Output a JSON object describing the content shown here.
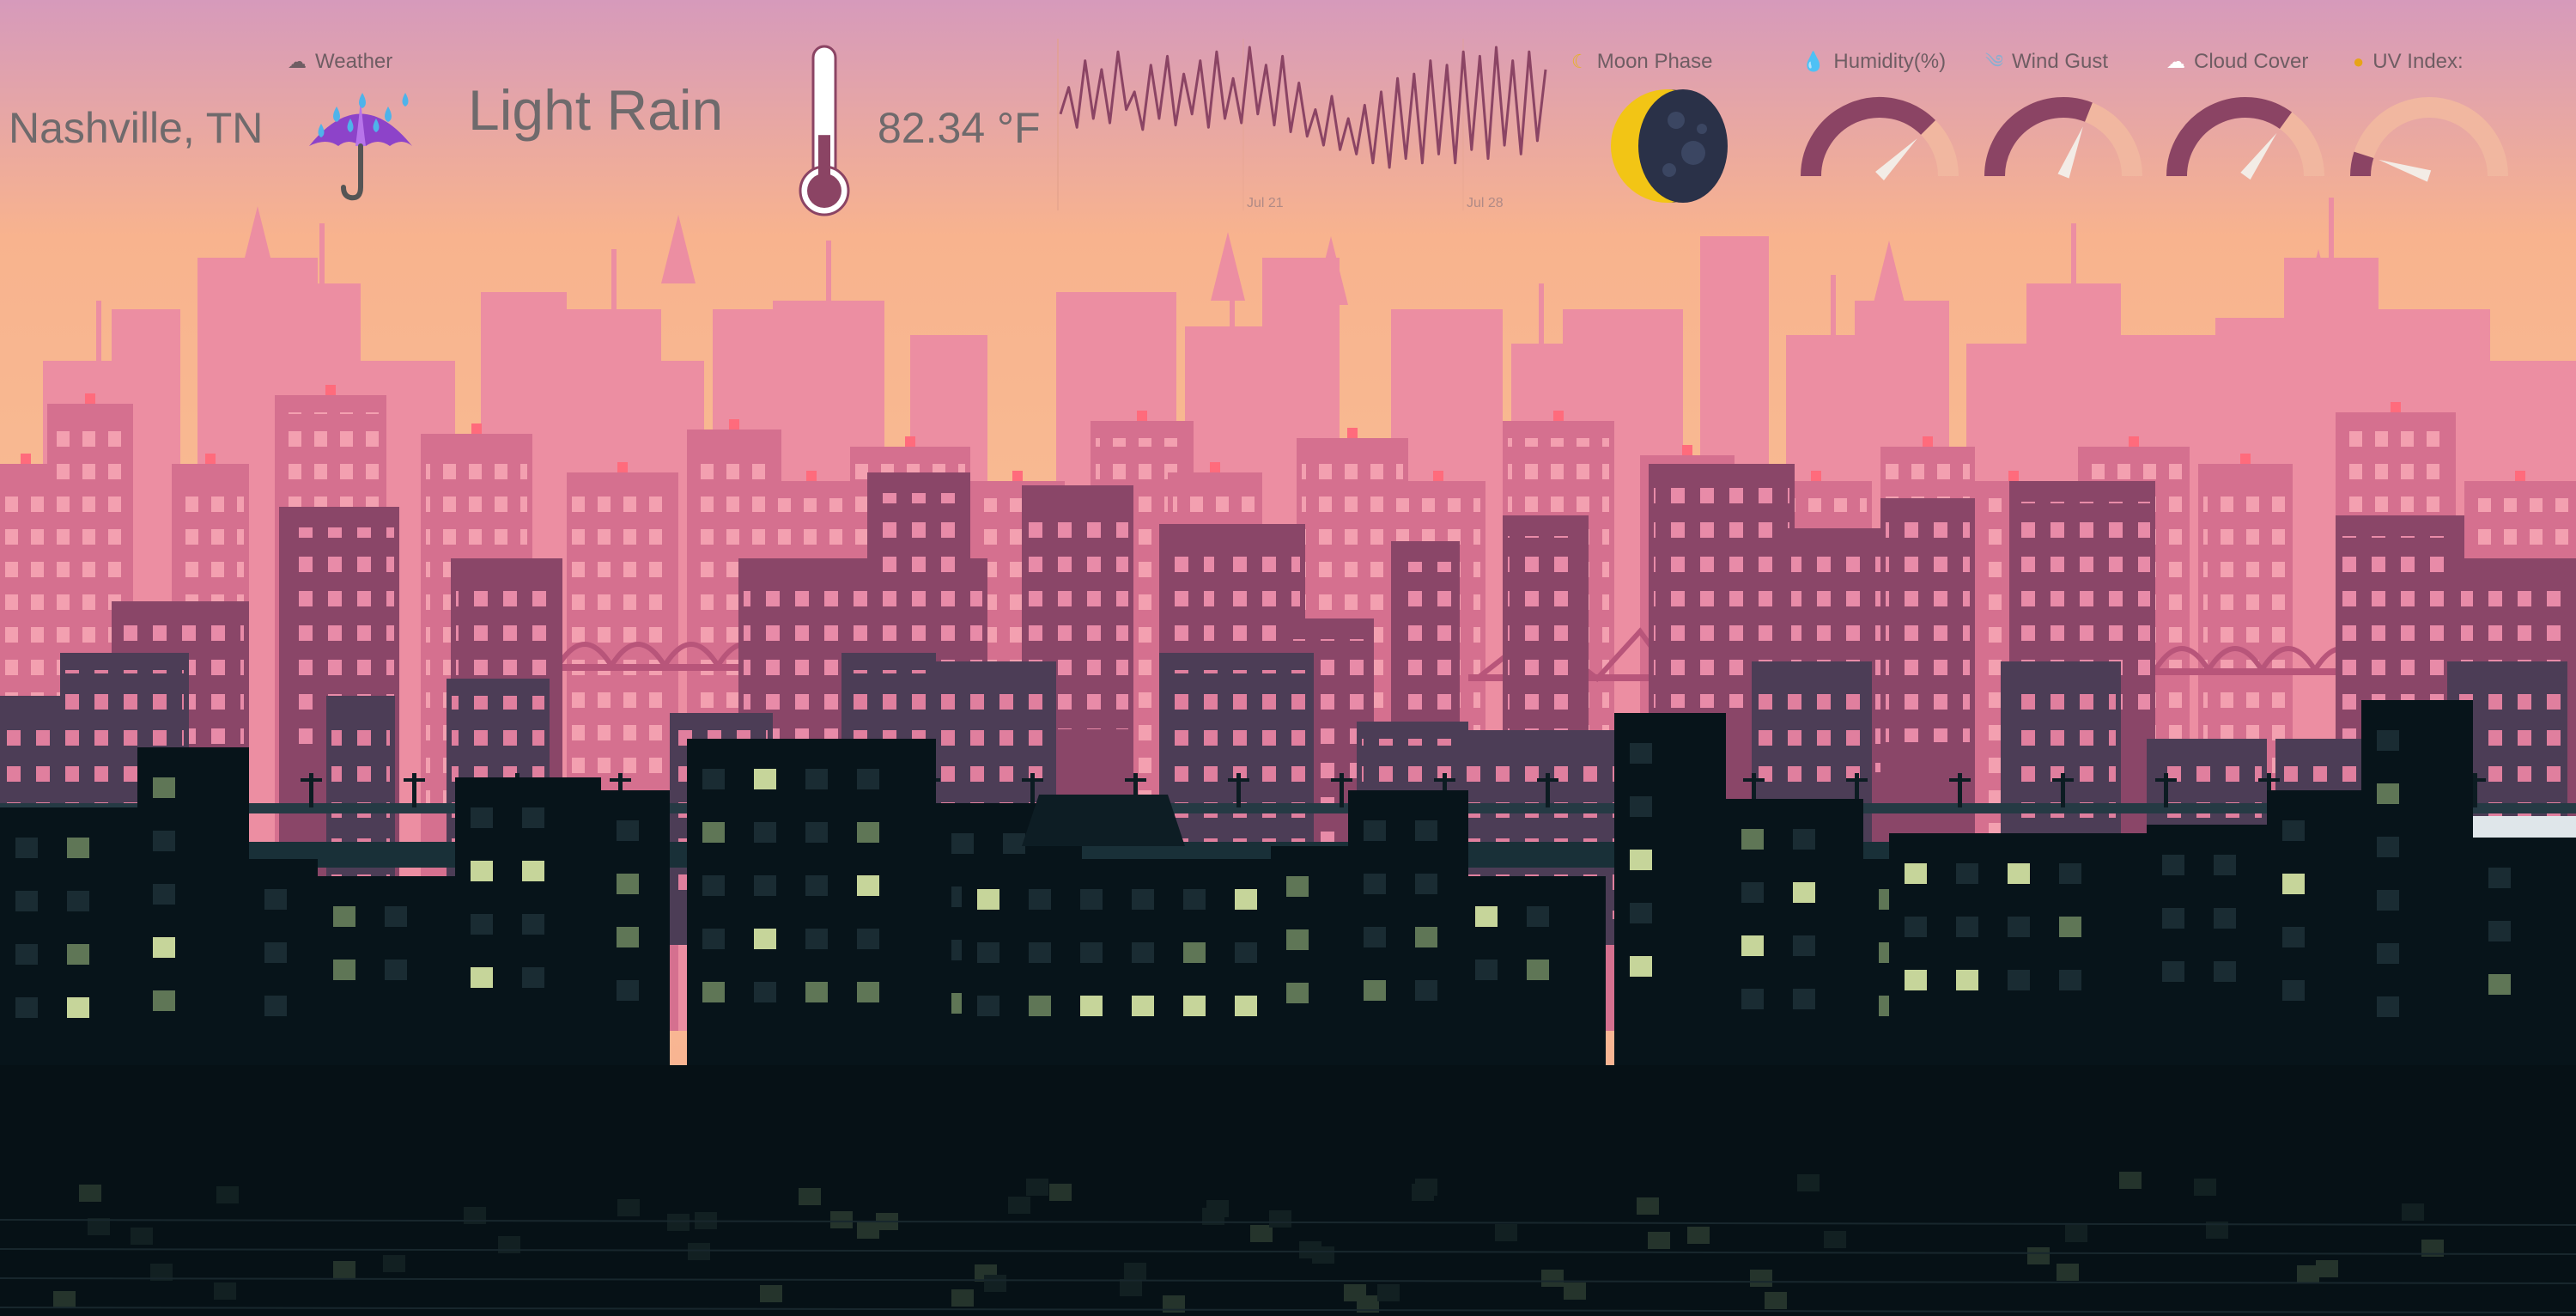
{
  "location": {
    "city": "Nashville, TN"
  },
  "weather": {
    "label": "Weather",
    "label_icon": "cloud-icon",
    "condition_icon": "umbrella-rain-icon",
    "condition": "Light Rain"
  },
  "temperature": {
    "value_text": "82.34 °F",
    "thermometer_fill_fraction": 0.4,
    "thermometer_color": "#8b4464"
  },
  "forecast_chart": {
    "type": "line",
    "x_ticks": [
      "Jul 21",
      "Jul 28"
    ],
    "color": "#8b4464",
    "values": [
      62,
      74,
      56,
      86,
      60,
      82,
      58,
      90,
      64,
      72,
      55,
      84,
      60,
      88,
      57,
      80,
      62,
      86,
      56,
      90,
      60,
      78,
      58,
      92,
      62,
      84,
      57,
      88,
      54,
      76,
      52,
      64,
      48,
      70,
      46,
      60,
      44,
      66,
      40,
      72,
      38,
      78,
      42,
      80,
      40,
      86,
      44,
      84,
      40,
      90,
      46,
      88,
      42,
      92,
      48,
      86,
      44,
      90,
      50,
      82
    ]
  },
  "moon_phase": {
    "label": "Moon Phase",
    "label_icon": "crescent-moon-icon"
  },
  "metrics": [
    {
      "label": "Humidity(%)",
      "icon": "droplet-icon",
      "value_fraction": 0.75
    },
    {
      "label": "Wind Gust",
      "icon": "wind-icon",
      "value_fraction": 0.62
    },
    {
      "label": "Cloud Cover",
      "icon": "cloud-icon",
      "value_fraction": 0.7
    },
    {
      "label": "UV Index:",
      "icon": "sun-icon",
      "value_fraction": 0.1
    }
  ],
  "colors": {
    "sky_top": "#d89ab8",
    "sky_mid": "#f8b58e",
    "sky_low": "#f9c194",
    "far_buildings": "#ec8ea2",
    "mid_buildings": "#d5708f",
    "near_buildings": "#8a4668",
    "dark_buildings": "#4c3d56",
    "foreground": "#07141a",
    "lit_window": "#c6d59a",
    "dim_window": "#5f7656",
    "gauge_fill": "#8b4464",
    "gauge_track": "#f1b7a0"
  }
}
